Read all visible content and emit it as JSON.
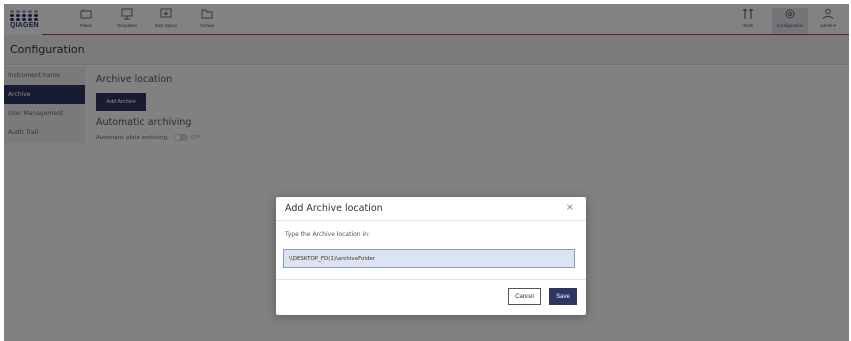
{
  "brand": {
    "logo_text": "QIAGEN"
  },
  "nav": {
    "left": [
      {
        "label": "Plates",
        "icon": "plates-icon"
      },
      {
        "label": "Templates",
        "icon": "templates-icon"
      },
      {
        "label": "Disk Space",
        "icon": "disk-space-icon"
      },
      {
        "label": "Archive",
        "icon": "archive-icon"
      }
    ],
    "right": [
      {
        "label": "Tools",
        "icon": "tools-icon"
      },
      {
        "label": "Configuration",
        "icon": "configuration-icon",
        "active": true
      },
      {
        "label": "admin ▾",
        "icon": "user-icon"
      }
    ]
  },
  "page": {
    "title": "Configuration"
  },
  "sidebar": {
    "items": [
      {
        "label": "Instrument name",
        "active": false
      },
      {
        "label": "Archive",
        "active": true
      },
      {
        "label": "User Management",
        "active": false
      },
      {
        "label": "Audit Trail",
        "active": false
      }
    ]
  },
  "content": {
    "archive_heading": "Archive location",
    "add_archive_label": "Add Archive",
    "auto_heading": "Automatic archiving",
    "auto_label": "Automatic plate archiving:",
    "toggle_state": "OFF"
  },
  "modal": {
    "title": "Add Archive location",
    "close_glyph": "×",
    "hint": "Type the Archive location in:",
    "input_value": "\\\\DESKTOP_FD(1)\\archiveFolder",
    "cancel_label": "Cancel",
    "save_label": "Save"
  },
  "colors": {
    "primary": "#2d3561",
    "accent_line": "#c0304a",
    "input_bg": "#dde4f1"
  }
}
